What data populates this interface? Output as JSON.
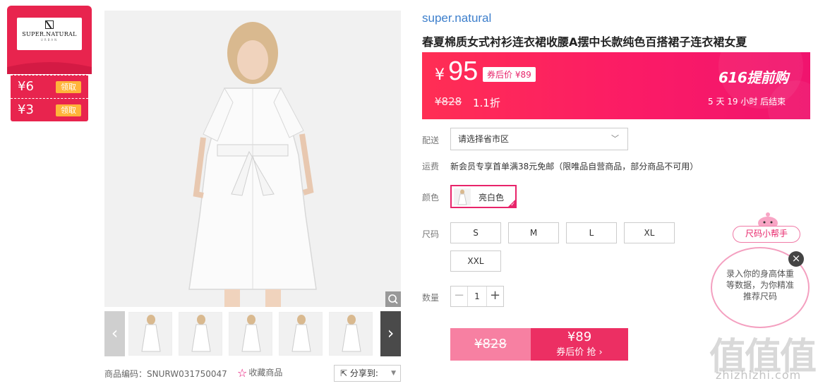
{
  "coupons": {
    "brand_logo_text": "SUPER.NATURAL",
    "brand_logo_sub": "URBAN",
    "items": [
      {
        "value": "¥6",
        "button": "领取"
      },
      {
        "value": "¥3",
        "button": "领取"
      }
    ]
  },
  "gallery": {
    "sku": "商品编码：SNURW031750047",
    "favorite": "收藏商品",
    "share": "分享到:",
    "thumbnail_count": 5
  },
  "product": {
    "brand": "super.natural",
    "title": "春夏棉质女式衬衫连衣裙收腰A摆中长款纯色百搭裙子连衣裙女夏"
  },
  "price": {
    "currency": "¥",
    "current": "95",
    "after_coupon": "券后价 ¥89",
    "original": "¥828",
    "discount": "1.1折",
    "event": "616提前购",
    "countdown": "5 天 19 小时 后结束"
  },
  "delivery": {
    "label": "配送",
    "region_placeholder": "请选择省市区"
  },
  "shipping": {
    "label": "运费",
    "text": "新会员专享首单满38元免邮（限唯品自营商品，部分商品不可用）"
  },
  "color": {
    "label": "颜色",
    "selected": "亮白色"
  },
  "size": {
    "label": "尺码",
    "options": [
      "S",
      "M",
      "L",
      "XL",
      "XXL"
    ]
  },
  "quantity": {
    "label": "数量",
    "value": "1",
    "minus": "−",
    "plus": "+"
  },
  "buy": {
    "original": "¥828",
    "price": "¥89",
    "cta": "券后价 抢 ›"
  },
  "size_helper": {
    "title": "尺码小帮手",
    "text": "录入你的身高体重等数据，为你精准推荐尺码",
    "close": "×"
  },
  "watermark": {
    "logo": "值值值",
    "url": "zhizhizhi.com"
  },
  "colors": {
    "accent": "#e8244e",
    "brand_link": "#3d7fcc",
    "coupon_button": "#ffb43a",
    "buy_light": "#f780a2",
    "buy_dark": "#ec2f63"
  }
}
